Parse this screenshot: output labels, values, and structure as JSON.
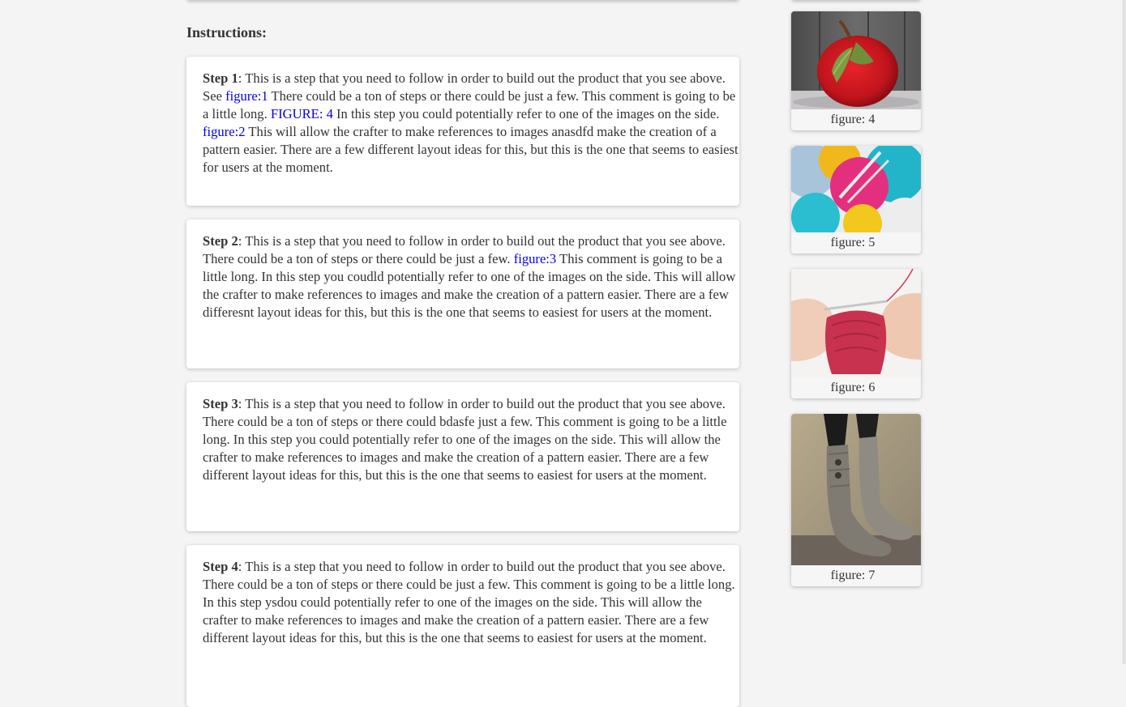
{
  "instructions": {
    "heading": "Instructions:",
    "steps": [
      {
        "label": "Step 1",
        "segments": [
          {
            "text": ": This is a step that you need to follow in order to build out the product that you see above. See "
          },
          {
            "link": "figure:1"
          },
          {
            "text": " There could be a ton of steps or there could be just a few. This comment is going to be a little long. "
          },
          {
            "link": "FIGURE: 4"
          },
          {
            "text": " In this step you could potentially refer to one of the images on the side. "
          },
          {
            "link": "figure:2"
          },
          {
            "text": " This will allow the crafter to make references to images anasdfd make the creation of a pattern easier. There are a few different layout ideas for this, but this is the one that seems to easiest for users at the moment."
          }
        ]
      },
      {
        "label": "Step 2",
        "segments": [
          {
            "text": ": This is a step that you need to follow in order to build out the product that you see above. There could be a ton of steps or there could be just a few. "
          },
          {
            "link": "figure:3"
          },
          {
            "text": " This comment is going to be a little long. In this step you coudld potentially refer to one of the images on the side. This will allow the crafter to make references to images and make the creation of a pattern easier. There are a few differesnt layout ideas for this, but this is the one that seems to easiest for users at the moment."
          }
        ]
      },
      {
        "label": "Step 3",
        "segments": [
          {
            "text": ": This is a step that you need to follow in order to build out the product that you see above. There could be a ton of steps or there could bdasfe just a few. This comment is going to be a little long. In this step you could potentially refer to one of the images on the side. This will allow the crafter to make references to images and make the creation of a pattern easier. There are a few different layout ideas for this, but this is the one that seems to easiest for users at the moment."
          }
        ]
      },
      {
        "label": "Step 4",
        "segments": [
          {
            "text": ": This is a step that you need to follow in order to build out the product that you see above. There could be a ton of steps or there could be just a few. This comment is going to be a little long. In this step ysdou could potentially refer to one of the images on the side. This will allow the crafter to make references to images and make the creation of a pattern easier. There are a few different layout ideas for this, but this is the one that seems to easiest for users at the moment."
          }
        ]
      }
    ]
  },
  "figures": [
    {
      "caption": "figure: 4",
      "image": "knitted-apple-photo"
    },
    {
      "caption": "figure: 5",
      "image": "yarn-balls-photo"
    },
    {
      "caption": "figure: 6",
      "image": "knitting-hands-photo"
    },
    {
      "caption": "figure: 7",
      "image": "knitted-boots-photo"
    }
  ],
  "colors": {
    "link": "#0000ee",
    "text": "#333333",
    "page_background": "#f4f4f4",
    "card_background": "#ffffff"
  }
}
